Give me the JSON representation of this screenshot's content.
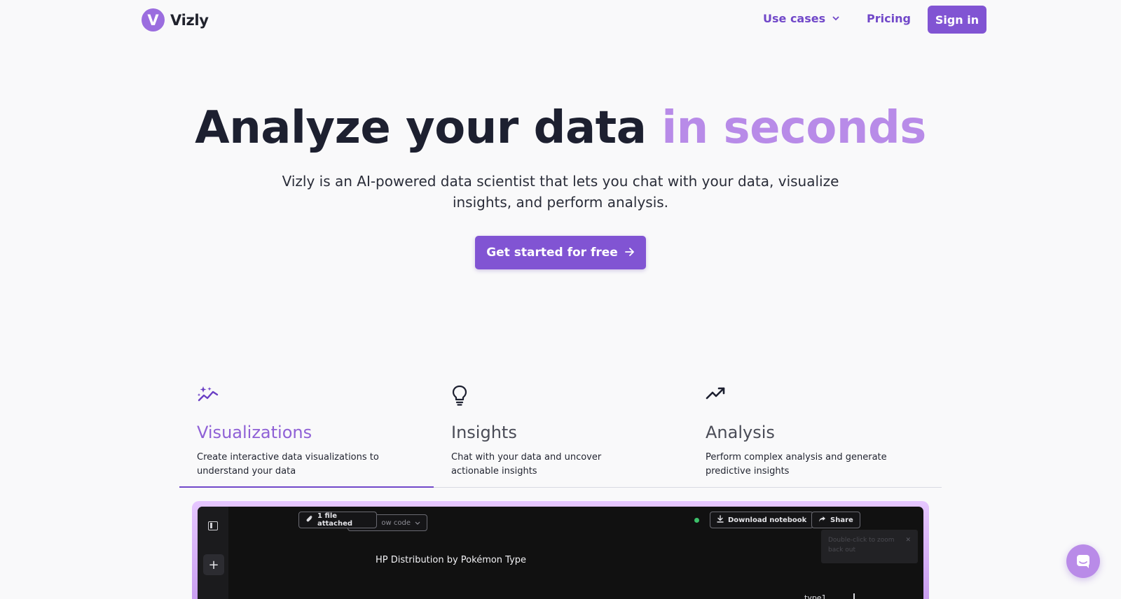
{
  "brand": {
    "logo_letter": "V",
    "name": "Vizly",
    "color": "#8154d3",
    "accent": "#b88be8"
  },
  "nav": {
    "use_cases": "Use cases",
    "pricing": "Pricing",
    "sign_in": "Sign in"
  },
  "hero": {
    "title_main": "Analyze your data ",
    "title_accent": "in seconds",
    "subtitle": "Vizly is an AI-powered data scientist that lets you chat with your data, visualize insights, and perform analysis.",
    "cta": "Get started for free"
  },
  "features": [
    {
      "icon": "sparkle-chart-icon",
      "title": "Visualizations",
      "desc": "Create interactive data visualizations to understand your data",
      "active": true
    },
    {
      "icon": "lightbulb-icon",
      "title": "Insights",
      "desc": "Chat with your data and uncover actionable insights",
      "active": false
    },
    {
      "icon": "trending-up-icon",
      "title": "Analysis",
      "desc": "Perform complex analysis and generate predictive insights",
      "active": false
    }
  ],
  "preview": {
    "file_attached": "1 file attached",
    "show_code": "ow code",
    "download_notebook": "Download notebook",
    "share": "Share",
    "hint": "Double-click to zoom back out",
    "chart_title": "HP Distribution by Pokémon Type",
    "legend_title": "type1"
  },
  "chat": {
    "icon": "chat-bubble-icon"
  }
}
